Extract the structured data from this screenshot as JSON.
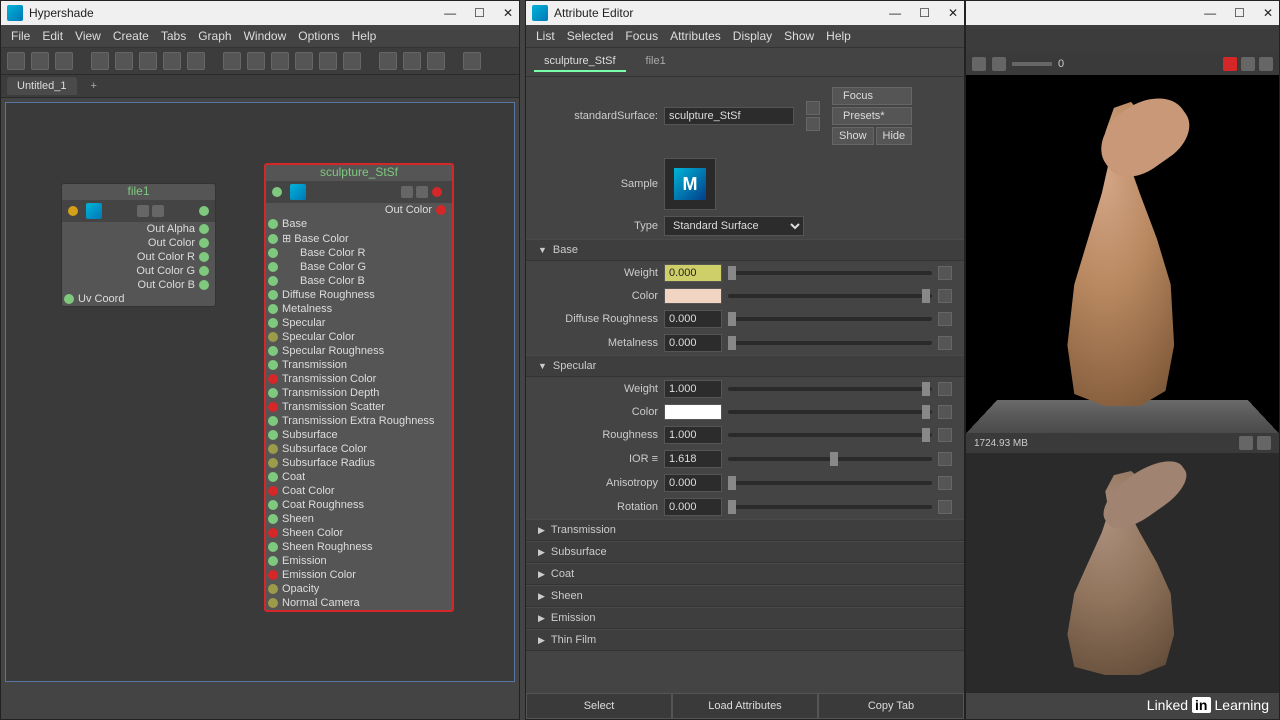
{
  "hypershade": {
    "title": "Hypershade",
    "menus": [
      "File",
      "Edit",
      "View",
      "Create",
      "Tabs",
      "Graph",
      "Window",
      "Options",
      "Help"
    ],
    "tab": "Untitled_1",
    "tab_add": "+",
    "node_file": {
      "title": "file1",
      "outputs": [
        "Out Alpha",
        "Out Color",
        "Out Color R",
        "Out Color G",
        "Out Color B"
      ],
      "inputs": [
        "Uv Coord"
      ]
    },
    "node_sculpt": {
      "title": "sculpture_StSf",
      "out": "Out Color",
      "attrs": [
        {
          "label": "Base",
          "port": "green"
        },
        {
          "label": "Base Color",
          "port": "green",
          "expand": true
        },
        {
          "label": "Base Color R",
          "port": "green",
          "indent": true
        },
        {
          "label": "Base Color G",
          "port": "green",
          "indent": true
        },
        {
          "label": "Base Color B",
          "port": "green",
          "indent": true
        },
        {
          "label": "Diffuse Roughness",
          "port": "green"
        },
        {
          "label": "Metalness",
          "port": "green"
        },
        {
          "label": "Specular",
          "port": "green"
        },
        {
          "label": "Specular Color",
          "port": "olive"
        },
        {
          "label": "Specular Roughness",
          "port": "green"
        },
        {
          "label": "Transmission",
          "port": "green"
        },
        {
          "label": "Transmission Color",
          "port": "red"
        },
        {
          "label": "Transmission Depth",
          "port": "green"
        },
        {
          "label": "Transmission Scatter",
          "port": "red"
        },
        {
          "label": "Transmission Extra Roughness",
          "port": "green"
        },
        {
          "label": "Subsurface",
          "port": "green"
        },
        {
          "label": "Subsurface Color",
          "port": "olive"
        },
        {
          "label": "Subsurface Radius",
          "port": "olive"
        },
        {
          "label": "Coat",
          "port": "green"
        },
        {
          "label": "Coat Color",
          "port": "red"
        },
        {
          "label": "Coat Roughness",
          "port": "green"
        },
        {
          "label": "Sheen",
          "port": "green"
        },
        {
          "label": "Sheen Color",
          "port": "red"
        },
        {
          "label": "Sheen Roughness",
          "port": "green"
        },
        {
          "label": "Emission",
          "port": "green"
        },
        {
          "label": "Emission Color",
          "port": "red"
        },
        {
          "label": "Opacity",
          "port": "olive"
        },
        {
          "label": "Normal Camera",
          "port": "olive"
        }
      ]
    }
  },
  "attr_editor": {
    "title": "Attribute Editor",
    "menus": [
      "List",
      "Selected",
      "Focus",
      "Attributes",
      "Display",
      "Show",
      "Help"
    ],
    "tabs": [
      "sculpture_StSf",
      "file1"
    ],
    "standardSurfaceLabel": "standardSurface:",
    "standardSurface": "sculpture_StSf",
    "buttons": {
      "focus": "Focus",
      "presets": "Presets*",
      "show": "Show",
      "hide": "Hide"
    },
    "sample_label": "Sample",
    "type_label": "Type",
    "type_value": "Standard Surface",
    "sections": {
      "base": {
        "title": "Base",
        "weight_label": "Weight",
        "weight": "0.000",
        "color_label": "Color",
        "color": "#f2d4c2",
        "diffuse_label": "Diffuse Roughness",
        "diffuse": "0.000",
        "metal_label": "Metalness",
        "metal": "0.000"
      },
      "specular": {
        "title": "Specular",
        "weight_label": "Weight",
        "weight": "1.000",
        "color_label": "Color",
        "color": "#ffffff",
        "rough_label": "Roughness",
        "rough": "1.000",
        "ior_label": "IOR ≡",
        "ior": "1.618",
        "aniso_label": "Anisotropy",
        "aniso": "0.000",
        "rot_label": "Rotation",
        "rot": "0.000"
      },
      "collapsed": [
        "Transmission",
        "Subsurface",
        "Coat",
        "Sheen",
        "Emission",
        "Thin Film"
      ]
    },
    "footer": {
      "select": "Select",
      "load": "Load Attributes",
      "copy": "Copy Tab"
    }
  },
  "viewport": {
    "top_value": "0",
    "memory": "1724.93 MB"
  },
  "branding": {
    "linked": "Linked",
    "in": "in",
    "learning": "Learning"
  }
}
